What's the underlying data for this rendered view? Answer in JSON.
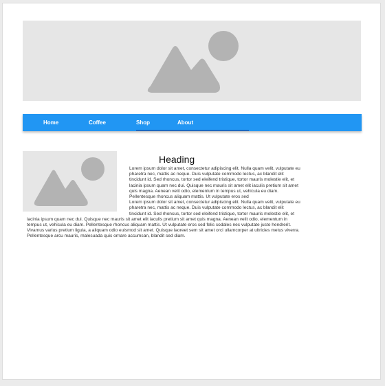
{
  "nav": {
    "items": [
      {
        "label": "Home"
      },
      {
        "label": "Coffee"
      },
      {
        "label": "Shop"
      },
      {
        "label": "About"
      }
    ],
    "active": "Shop",
    "color": "#2196f3"
  },
  "images": {
    "hero": {
      "icon": "image-placeholder-icon"
    },
    "thumbnail": {
      "icon": "image-placeholder-icon"
    }
  },
  "content": {
    "heading": "Heading",
    "paragraphs": [
      "Lorem ipsum dolor sit amet, consectetur adipiscing elit. Nulla quam velit, vulputate eu pharetra nec, mattis ac neque. Duis vulputate commodo lectus, ac blandit elit tincidunt id. Sed rhoncus, tortor sed eleifend tristique, tortor mauris molestie elit, et lacinia ipsum quam nec dui. Quisque nec mauris sit amet elit iaculis pretium sit amet quis magna. Aenean velit odio, elementum in tempus ut, vehicula eu diam. Pellentesque rhoncus aliquam mattis. Ut vulputate eros sed",
      "Lorem ipsum dolor sit amet, consectetur adipiscing elit. Nulla quam velit, vulputate eu pharetra nec, mattis ac neque. Duis vulputate commodo lectus, ac blandit elit tincidunt id. Sed rhoncus, tortor sed eleifend tristique, tortor mauris molestie elit, et lacinia ipsum quam nec dui. Quisque nec mauris sit amet elit iaculis pretium sit amet quis magna. Aenean velit odio, elementum in tempus ut, vehicula eu diam. Pellentesque rhoncus aliquam mattis. Ut vulputate eros sed felis sodales nec vulputate justo hendrerit. Vivamus varius pretium ligula, a aliquam odio euismod sit amet. Quisque laoreet sem sit amet orci ullamcorper at ultricies metus viverra. Pellentesque arcu mauris, malesuada quis ornare accumsan, blandit sed diam."
    ]
  }
}
